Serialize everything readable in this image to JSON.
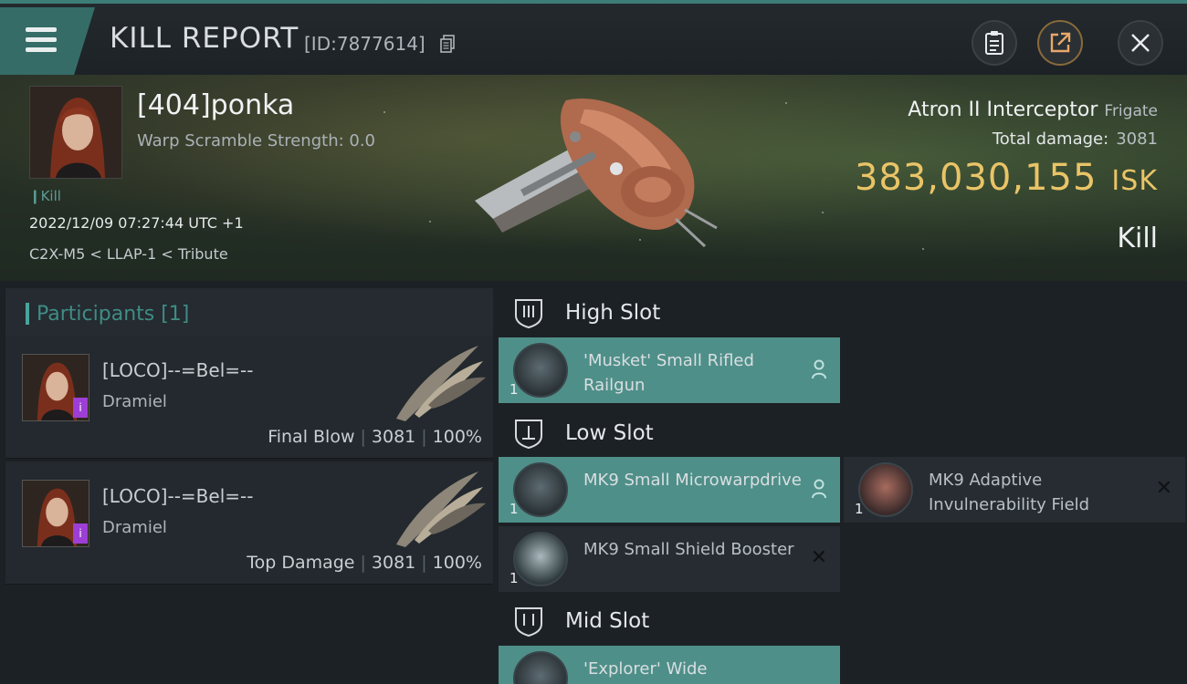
{
  "header": {
    "title": "KILL REPORT",
    "report_id": "[ID:7877614]"
  },
  "victim": {
    "name": "[404]ponka",
    "warp_scramble": "Warp Scramble Strength: 0.0",
    "kill_tag": "Kill",
    "datetime": "2022/12/09 07:27:44 UTC +1",
    "location": "C2X-M5 < LLAP-1 < Tribute",
    "ship_name": "Atron II Interceptor",
    "ship_class": "Frigate",
    "total_damage_label": "Total damage:",
    "total_damage": "3081",
    "isk_value": "383,030,155",
    "isk_unit": "ISK",
    "result": "Kill"
  },
  "participants": {
    "header": "Participants [1]",
    "rows": [
      {
        "name": "[LOCO]--=Bel=--",
        "ship": "Dramiel",
        "role": "Final Blow",
        "damage": "3081",
        "percent": "100%"
      },
      {
        "name": "[LOCO]--=Bel=--",
        "ship": "Dramiel",
        "role": "Top Damage",
        "damage": "3081",
        "percent": "100%"
      }
    ]
  },
  "fitting": {
    "high_slot": {
      "label": "High Slot",
      "items": [
        {
          "qty": "1",
          "name": "'Musket' Small Rifled Railgun",
          "state": "fitted"
        }
      ]
    },
    "low_slot": {
      "label": "Low Slot",
      "items": [
        {
          "qty": "1",
          "name": "MK9 Small Microwarpdrive",
          "state": "fitted"
        },
        {
          "qty": "1",
          "name": "MK9 Adaptive Invulnerability Field",
          "state": "destroyed"
        },
        {
          "qty": "1",
          "name": "MK9 Small Shield Booster",
          "state": "destroyed"
        }
      ]
    },
    "mid_slot": {
      "label": "Mid Slot",
      "items": [
        {
          "qty": "",
          "name": "'Explorer' Wide",
          "state": "fitted"
        }
      ]
    }
  },
  "colors": {
    "accent_teal": "#4f8f89",
    "isk_gold": "#e9c467",
    "header_teal": "#356c67"
  },
  "icons": [
    "menu-icon",
    "copy-icon",
    "clipboard-icon",
    "share-icon",
    "close-icon",
    "slot-shield-icon",
    "person-icon",
    "destroyed-x-icon"
  ]
}
